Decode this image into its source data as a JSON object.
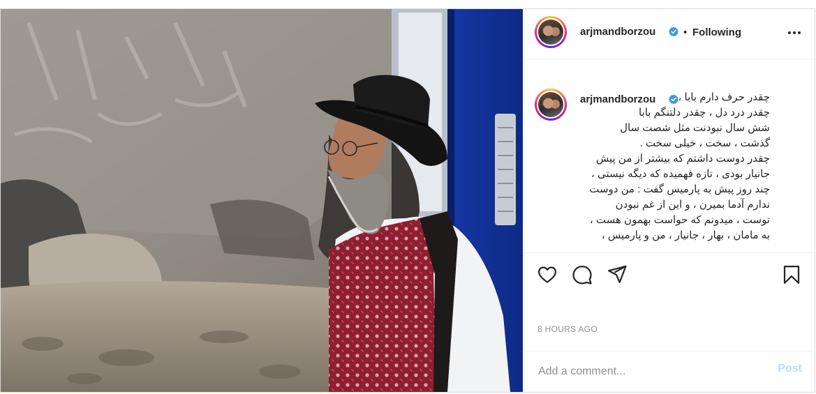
{
  "post": {
    "username": "arjmandborzou",
    "separator": "•",
    "follow_status": "Following",
    "caption_lines": [
      "چقدر حرف دارم بابا ،",
      "چقدر درد دل ، چقدر دلتنگم بابا",
      "شش سال نبودنت مثل شصت سال",
      "گذشت ، سخت ، خیلی سخت .",
      "چقدر دوست داشتم که بیشتر از من پیش",
      "جانیار بودی ، تازه فهمیده که دیگه نیستی ،",
      "چند روز پیش به پارمیس گفت : من دوست",
      "ندارم آدما بمیرن ، و این از غم نبودن",
      "توست ، میدونم که حواست بهمون هست ،",
      "به مامان ، بهار ، جانیار ، من و پارمیس ،"
    ],
    "timestamp": "8 HOURS AGO",
    "comment_placeholder": "Add a comment...",
    "post_label": "Post"
  },
  "icons": {
    "verified": "verified-badge-icon",
    "more": "more-options-icon",
    "like": "heart-icon",
    "comment": "comment-bubble-icon",
    "share": "paper-plane-icon",
    "save": "bookmark-icon"
  },
  "colors": {
    "verified_blue": "#3897f0",
    "post_button_disabled": "#b2dffc",
    "muted_text": "#8e8e8e"
  }
}
